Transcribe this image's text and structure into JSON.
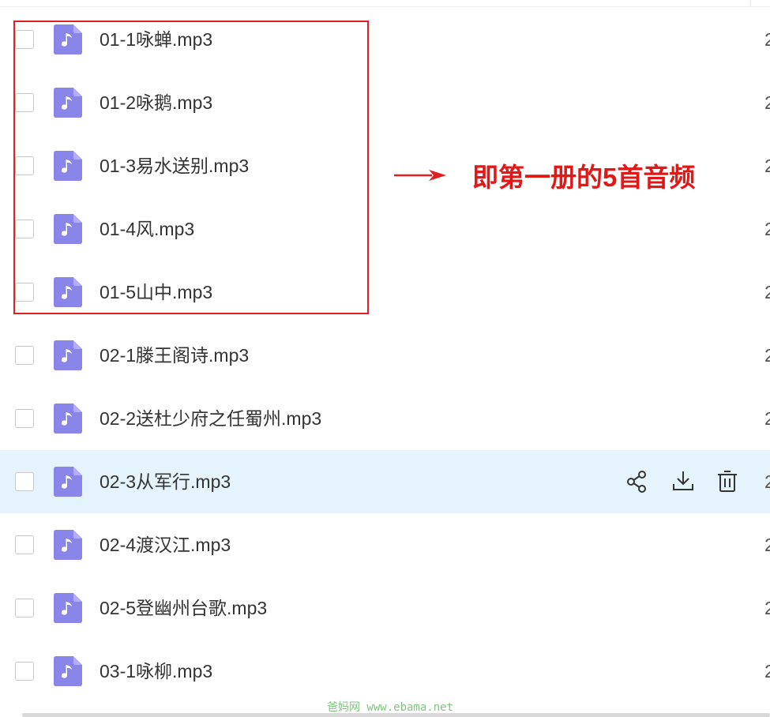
{
  "files": [
    {
      "name": "01-1咏蝉.mp3",
      "date_prefix": "2"
    },
    {
      "name": "01-2咏鹅.mp3",
      "date_prefix": "2"
    },
    {
      "name": "01-3易水送别.mp3",
      "date_prefix": "2"
    },
    {
      "name": "01-4风.mp3",
      "date_prefix": "2"
    },
    {
      "name": "01-5山中.mp3",
      "date_prefix": "2"
    },
    {
      "name": "02-1滕王阁诗.mp3",
      "date_prefix": "2"
    },
    {
      "name": "02-2送杜少府之任蜀州.mp3",
      "date_prefix": "2"
    },
    {
      "name": "02-3从军行.mp3",
      "date_prefix": "2"
    },
    {
      "name": "02-4渡汉江.mp3",
      "date_prefix": "2"
    },
    {
      "name": "02-5登幽州台歌.mp3",
      "date_prefix": "2"
    },
    {
      "name": "03-1咏柳.mp3",
      "date_prefix": "2"
    }
  ],
  "hovered_index": 7,
  "row_actions": [
    {
      "icon": "share-icon",
      "action": "share"
    },
    {
      "icon": "download-icon",
      "action": "download"
    },
    {
      "icon": "trash-icon",
      "action": "delete"
    }
  ],
  "annotation": {
    "text": "即第一册的5首音频",
    "color": "#e01818"
  },
  "watermark": "爸妈网 www.ebama.net",
  "colors": {
    "file_icon": "#8a85e8",
    "hover_row": "#e5f4fc",
    "highlight_border": "#e02020"
  }
}
